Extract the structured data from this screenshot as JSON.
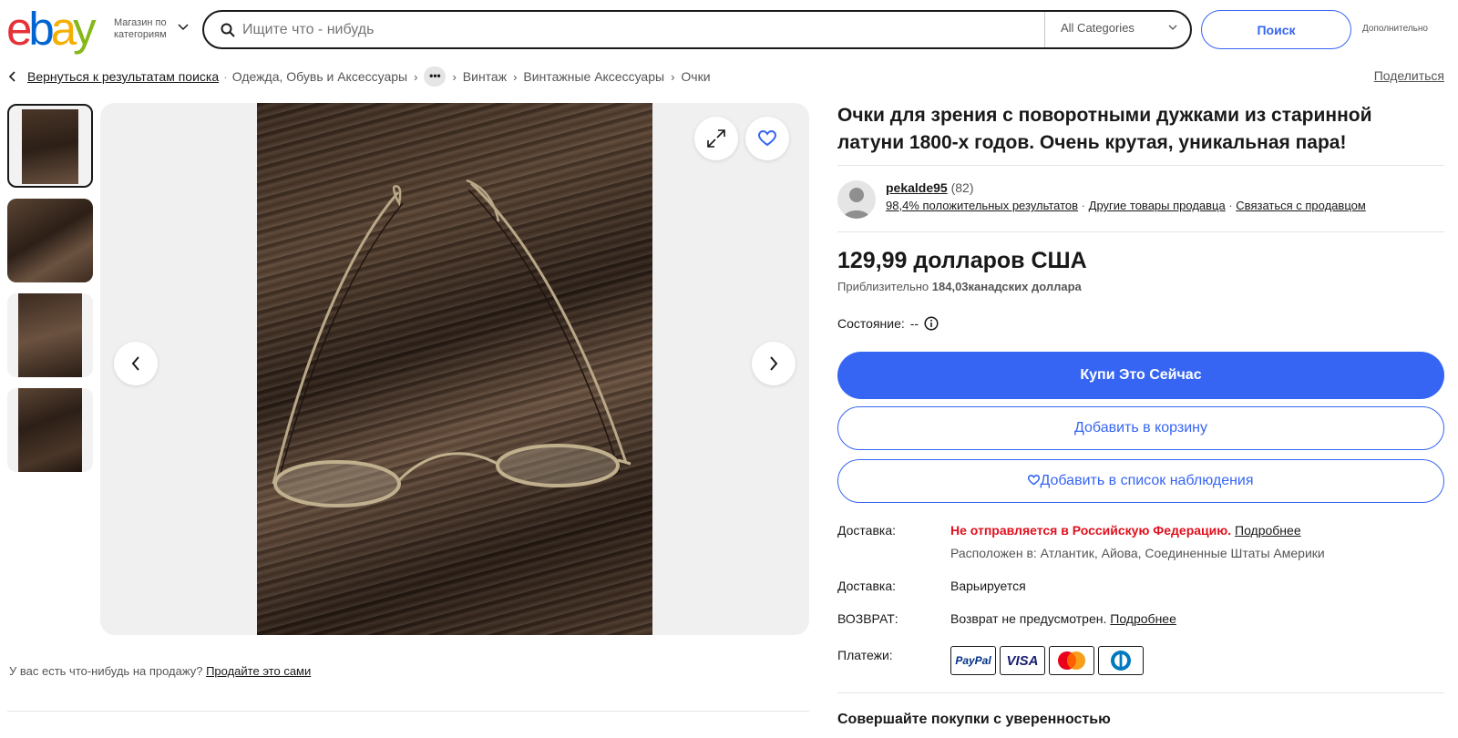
{
  "header": {
    "logo_letters": [
      "e",
      "b",
      "a",
      "y"
    ],
    "shop_by_category": "Магазин по категориям",
    "search_placeholder": "Ищите что - нибудь",
    "category": "All Categories",
    "search_button": "Поиск",
    "advanced": "Дополнительно"
  },
  "breadcrumb": {
    "back": "Вернуться к результатам поиска",
    "items": [
      "Одежда, Обувь и Аксессуары",
      "Винтаж",
      "Винтажные Аксессуары",
      "Очки"
    ],
    "more": "•••"
  },
  "share": "Поделиться",
  "listing": {
    "title": "Очки для зрения с поворотными дужками из старинной латуни 1800-х годов. Очень крутая, уникальная пара!",
    "seller": {
      "name": "pekalde95",
      "count": "(82)",
      "positive": "98,4% положительных результатов",
      "other_items": "Другие товары продавца",
      "contact": "Связаться с продавцом"
    },
    "price": "129,99 долларов США",
    "approx_prefix": "Приблизительно",
    "approx_value": "184,03",
    "approx_currency": "канадских доллара",
    "condition_label": "Состояние:",
    "condition_value": "--",
    "buy_now": "Купи Это Сейчас",
    "add_to_cart": "Добавить в корзину",
    "watchlist": "Добавить в список наблюдения",
    "shipping_label": "Доставка:",
    "shipping_warning": "Не отправляется в Российскую Федерацию.",
    "shipping_more": "Подробнее",
    "located": "Расположен в: Атлантик, Айова, Соединенные Штаты Америки",
    "delivery_label": "Доставка:",
    "delivery_value": "Варьируется",
    "returns_label": "ВОЗВРАТ:",
    "returns_value": "Возврат не предусмотрен.",
    "returns_more": "Подробнее",
    "payments_label": "Платежи:",
    "payments": [
      "PayPal",
      "VISA",
      "Mastercard",
      "Diners Club"
    ],
    "shop_confidence": "Совершайте покупки с уверенностью"
  },
  "sell_prompt": {
    "text": "У вас есть что-нибудь на продажу?",
    "link": "Продайте это сами"
  },
  "colors": {
    "ebay_red": "#e53238",
    "ebay_blue": "#0064d2",
    "ebay_yellow": "#f5af02",
    "ebay_green": "#86b817",
    "accent": "#3665f3",
    "warning": "#e0101d"
  }
}
